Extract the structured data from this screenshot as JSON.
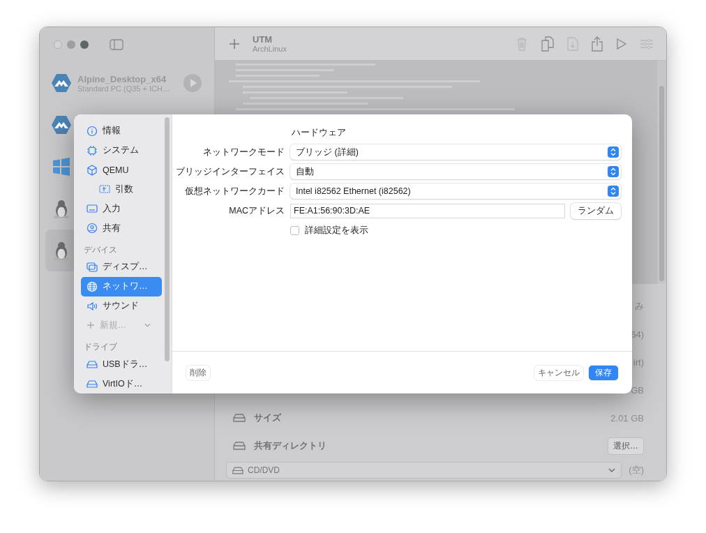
{
  "vm_list": [
    {
      "kind": "alpine",
      "name": "Alpine_Desktop_x64",
      "subtitle": "Standard PC (Q35 + ICH…",
      "selected": false
    },
    {
      "kind": "alpine",
      "selected": false
    },
    {
      "kind": "windows",
      "selected": false
    },
    {
      "kind": "linux",
      "selected": false
    },
    {
      "kind": "linux",
      "selected": true
    }
  ],
  "toolbar": {
    "title": "UTM",
    "subtitle": "ArchLinux"
  },
  "details": {
    "rows": [
      {
        "value": "み"
      },
      {
        "value": "64)"
      },
      {
        "value": "irt)"
      },
      {
        "value": "GB"
      },
      {
        "kind": "text",
        "label": "サイズ",
        "value": "2.01 GB"
      },
      {
        "kind": "button",
        "label": "共有ディレクトリ",
        "button": "選択…"
      }
    ],
    "drive": {
      "value": "CD/DVD",
      "status": "(空)"
    }
  },
  "sheet": {
    "sidebar": [
      {
        "kind": "info",
        "label": "情報",
        "selected": false
      },
      {
        "kind": "chip",
        "label": "システム",
        "selected": false
      },
      {
        "kind": "cube",
        "label": "QEMU",
        "selected": false,
        "children": [
          {
            "kind": "args",
            "label": "引数",
            "selected": false
          }
        ]
      },
      {
        "kind": "keyboard",
        "label": "入力",
        "selected": false
      },
      {
        "kind": "person",
        "label": "共有",
        "selected": false
      },
      {
        "kind": "section",
        "label": "デバイス"
      },
      {
        "kind": "display",
        "label": "ディスプ…",
        "selected": false
      },
      {
        "kind": "globe",
        "label": "ネットワ…",
        "selected": true
      },
      {
        "kind": "speaker",
        "label": "サウンド",
        "selected": false
      },
      {
        "kind": "add",
        "label": "新規…",
        "disabled": true
      },
      {
        "kind": "section",
        "label": "ドライブ"
      },
      {
        "kind": "drive",
        "label": "USBドラ…",
        "selected": false
      },
      {
        "kind": "drive",
        "label": "VirtIOド…",
        "selected": false
      }
    ],
    "form": {
      "section_title": "ハードウェア",
      "fields": [
        {
          "kind": "popup",
          "label": "ネットワークモード",
          "value": "ブリッジ (詳細)"
        },
        {
          "kind": "popup",
          "label": "ブリッジインターフェイス",
          "value": "自動"
        },
        {
          "kind": "popup",
          "label": "仮想ネットワークカード",
          "value": "Intel i82562 Ethernet (i82562)"
        },
        {
          "kind": "text",
          "label": "MACアドレス",
          "value": "FE:A1:56:90:3D:AE",
          "button": "ランダム"
        }
      ],
      "checkbox": {
        "label": "詳細設定を表示",
        "checked": false
      }
    },
    "footer": {
      "delete": "削除",
      "cancel": "キャンセル",
      "save": "保存"
    }
  }
}
